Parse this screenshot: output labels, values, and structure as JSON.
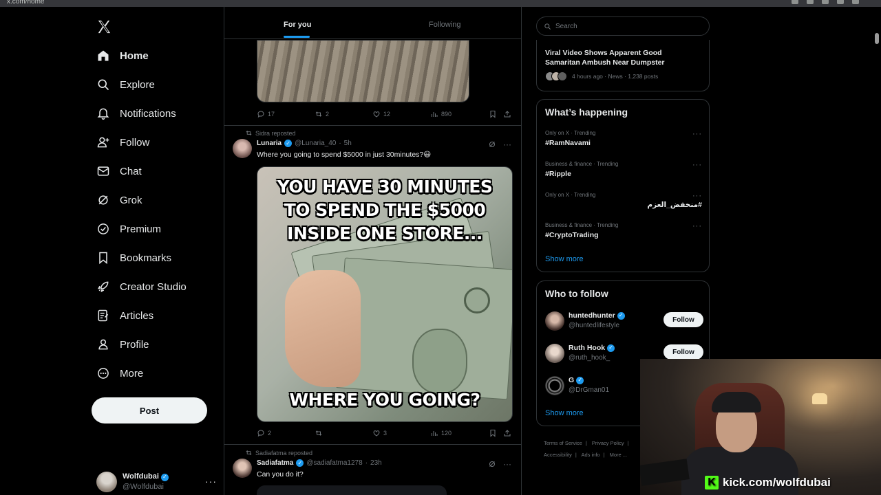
{
  "browser": {
    "url": "x.com/home"
  },
  "nav": {
    "items": [
      {
        "label": "Home",
        "icon": "home-icon"
      },
      {
        "label": "Explore",
        "icon": "search-icon"
      },
      {
        "label": "Notifications",
        "icon": "bell-icon"
      },
      {
        "label": "Follow",
        "icon": "person-plus-icon"
      },
      {
        "label": "Chat",
        "icon": "mail-icon"
      },
      {
        "label": "Grok",
        "icon": "grok-icon"
      },
      {
        "label": "Premium",
        "icon": "verified-icon"
      },
      {
        "label": "Bookmarks",
        "icon": "bookmark-icon"
      },
      {
        "label": "Creator Studio",
        "icon": "rocket-icon"
      },
      {
        "label": "Articles",
        "icon": "article-icon"
      },
      {
        "label": "Profile",
        "icon": "person-icon"
      },
      {
        "label": "More",
        "icon": "more-circle-icon"
      }
    ],
    "post_label": "Post",
    "account": {
      "name": "Wolfdubai",
      "handle": "@Wolfdubai"
    }
  },
  "feed": {
    "tabs": {
      "for_you": "For you",
      "following": "Following"
    },
    "tweet0": {
      "replies": "17",
      "reposts": "2",
      "likes": "12",
      "views": "890"
    },
    "tweet1": {
      "repost_by": "Sidra reposted",
      "name": "Lunaria",
      "handle": "@Lunaria_40",
      "time": "5h",
      "text": "Where you going to spend $5000 in just 30minutes?😃",
      "meme_top": "YOU HAVE 30 MINUTES TO SPEND THE $5000 INSIDE ONE STORE...",
      "meme_bottom": "WHERE YOU GOING?",
      "replies": "2",
      "reposts": "",
      "likes": "3",
      "views": "120"
    },
    "tweet2": {
      "repost_by": "Sadiafatma reposted",
      "name": "Sadiafatma",
      "handle": "@sadiafatma1278",
      "time": "23h",
      "text": "Can you do it?"
    }
  },
  "right": {
    "search_placeholder": "Search",
    "news": {
      "title": "Viral Video Shows Apparent Good Samaritan Ambush Near Dumpster",
      "meta": "4 hours ago · News · 1,238 posts"
    },
    "happening": {
      "title": "What’s happening",
      "trends": [
        {
          "category": "Only on X · Trending",
          "tag": "#RamNavami"
        },
        {
          "category": "Business & finance · Trending",
          "tag": "#Ripple"
        },
        {
          "category": "Only on X · Trending",
          "tag": "#منخفض_العزم"
        },
        {
          "category": "Business & finance · Trending",
          "tag": "#CryptoTrading"
        }
      ],
      "show_more": "Show more"
    },
    "who_to_follow": {
      "title": "Who to follow",
      "users": [
        {
          "name": "huntedhunter",
          "handle": "@huntedlifestyle",
          "button": "Follow"
        },
        {
          "name": "Ruth Hook",
          "handle": "@ruth_hook_",
          "button": "Follow"
        },
        {
          "name": "G",
          "handle": "@DrGman01",
          "button": ""
        }
      ],
      "show_more": "Show more"
    },
    "footer": [
      "Terms of Service",
      "|",
      "Privacy Policy",
      "|",
      "Accessibility",
      "|",
      "Ads info",
      "|",
      "More ..."
    ]
  },
  "overlay": {
    "kick_text": "kick.com/wolfdubai"
  },
  "colors": {
    "accent": "#1d9bf0",
    "background": "#000000",
    "border": "#2f3336",
    "muted": "#71767b",
    "kick_green": "#53fc18"
  }
}
